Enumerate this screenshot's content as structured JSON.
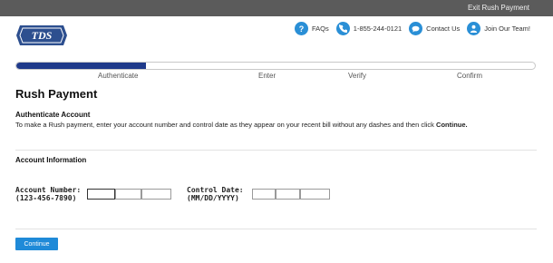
{
  "topbar": {
    "exit_label": "Exit Rush Payment"
  },
  "header": {
    "logo_text": "TDS",
    "help": {
      "faqs": "FAQs",
      "phone": "1-855-244-0121",
      "contact": "Contact Us",
      "join": "Join Our Team!"
    }
  },
  "progress": {
    "fraction": 0.25,
    "steps": [
      "Authenticate",
      "Enter",
      "Verify",
      "Confirm"
    ]
  },
  "page": {
    "title": "Rush Payment",
    "auth_heading": "Authenticate Account",
    "instructions": "To make a Rush payment, enter your account number and control date as they appear on your recent bill without any dashes and then click",
    "instructions_bold": "Continue.",
    "account_heading": "Account Information"
  },
  "form": {
    "account_label_1": "Account Number:",
    "account_label_2": "(123-456-7890)",
    "date_label_1": "Control Date:",
    "date_label_2": "(MM/DD/YYYY)",
    "account_values": [
      "",
      "",
      ""
    ],
    "date_values": [
      "",
      "",
      ""
    ]
  },
  "actions": {
    "continue_label": "Continue"
  },
  "colors": {
    "brand_blue": "#1f3a8a",
    "accent_blue": "#1f8ad8",
    "topbar_gray": "#5b5b5b"
  }
}
